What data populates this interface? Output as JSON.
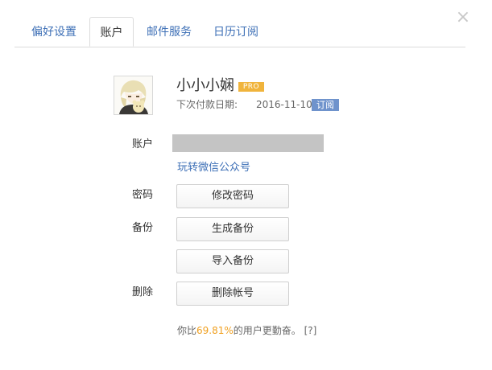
{
  "dialog": {
    "close_symbol": "×"
  },
  "tabs": [
    {
      "label": "偏好设置",
      "active": false
    },
    {
      "label": "账户",
      "active": true
    },
    {
      "label": "邮件服务",
      "active": false
    },
    {
      "label": "日历订阅",
      "active": false
    }
  ],
  "profile": {
    "username": "小小小娴",
    "pro_badge": "PRO",
    "due_label": "下次付款日期:",
    "due_date": "2016-11-10",
    "subscribe_label": "订阅",
    "avatar_icon": "avatar-anime-character"
  },
  "account": {
    "label": "账户",
    "wechat_link": "玩转微信公众号"
  },
  "password": {
    "label": "密码",
    "button": "修改密码"
  },
  "backup": {
    "label": "备份",
    "generate_button": "生成备份",
    "import_button": "导入备份"
  },
  "delete": {
    "label": "删除",
    "button": "删除帐号"
  },
  "footer": {
    "prefix": "你比",
    "percent": "69.81%",
    "suffix": "的用户更勤奋。",
    "help": "[?]"
  },
  "colors": {
    "link_blue": "#3d6fb6",
    "pro_orange": "#f0b43c",
    "subscribe_blue": "#6f93cc",
    "percent_orange": "#f0a020",
    "masked_gray": "#c4c4c4"
  }
}
